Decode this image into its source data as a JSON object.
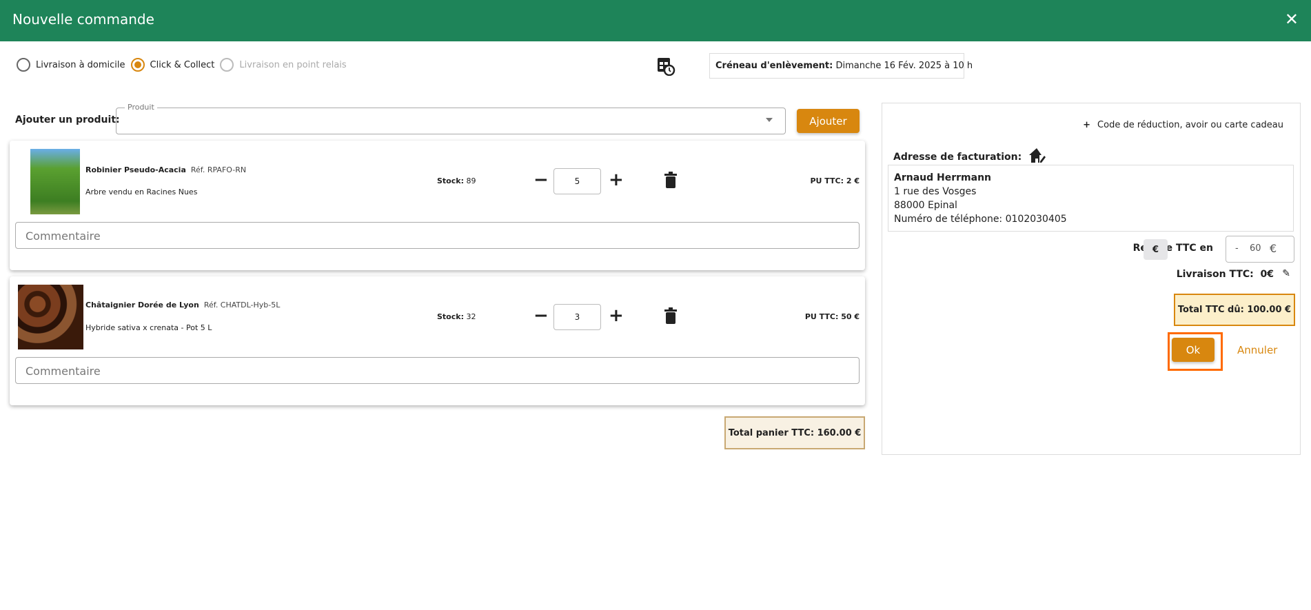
{
  "header": {
    "title": "Nouvelle commande",
    "close": "✕"
  },
  "delivery_options": [
    {
      "label": "Livraison à domicile",
      "state": "unselected"
    },
    {
      "label": "Click & Collect",
      "state": "selected"
    },
    {
      "label": "Livraison en point relais",
      "state": "disabled"
    }
  ],
  "slot": {
    "label": "Créneau d'enlèvement:",
    "value": "Dimanche 16 Fév. 2025 à 10 h"
  },
  "add_product": {
    "label": "Ajouter un produit:",
    "field_label": "Produit",
    "value": "",
    "button": "Ajouter"
  },
  "products": [
    {
      "name": "Robinier Pseudo-Acacia",
      "ref": "Réf. RPAFO-RN",
      "description": "Arbre vendu en Racines Nues",
      "stock_label": "Stock:",
      "stock": "89",
      "quantity": "5",
      "unit_price": "PU TTC: 2 €",
      "comment_placeholder": "Commentaire",
      "image_color": "#4f9a2f"
    },
    {
      "name": "Châtaignier Dorée de Lyon",
      "ref": "Réf. CHATDL-Hyb-5L",
      "description": "Hybride sativa x crenata - Pot 5 L",
      "stock_label": "Stock:",
      "stock": "32",
      "quantity": "3",
      "unit_price": "PU TTC: 50 €",
      "comment_placeholder": "Commentaire",
      "image_color": "#5a2f18"
    }
  ],
  "cart_total": "Total panier TTC: 160.00 €",
  "summary": {
    "discount_code": "Code de réduction, avoir ou carte cadeau",
    "billing_label": "Adresse de facturation:",
    "address": {
      "name": "Arnaud Herrmann",
      "street": "1 rue des Vosges",
      "city": "88000 Epinal",
      "phone": "Numéro de téléphone: 0102030405"
    },
    "remise_label": "Remise TTC en",
    "remise_unit": "€",
    "remise_sign": "-",
    "remise_value": "60",
    "remise_suffix": "€",
    "delivery": "Livraison TTC:  0€",
    "total_due": "Total TTC dû: 100.00 €",
    "ok": "Ok",
    "cancel": "Annuler"
  },
  "colors": {
    "header": "#1e8459",
    "accent": "#d8870f",
    "focus": "#ff6a00"
  }
}
